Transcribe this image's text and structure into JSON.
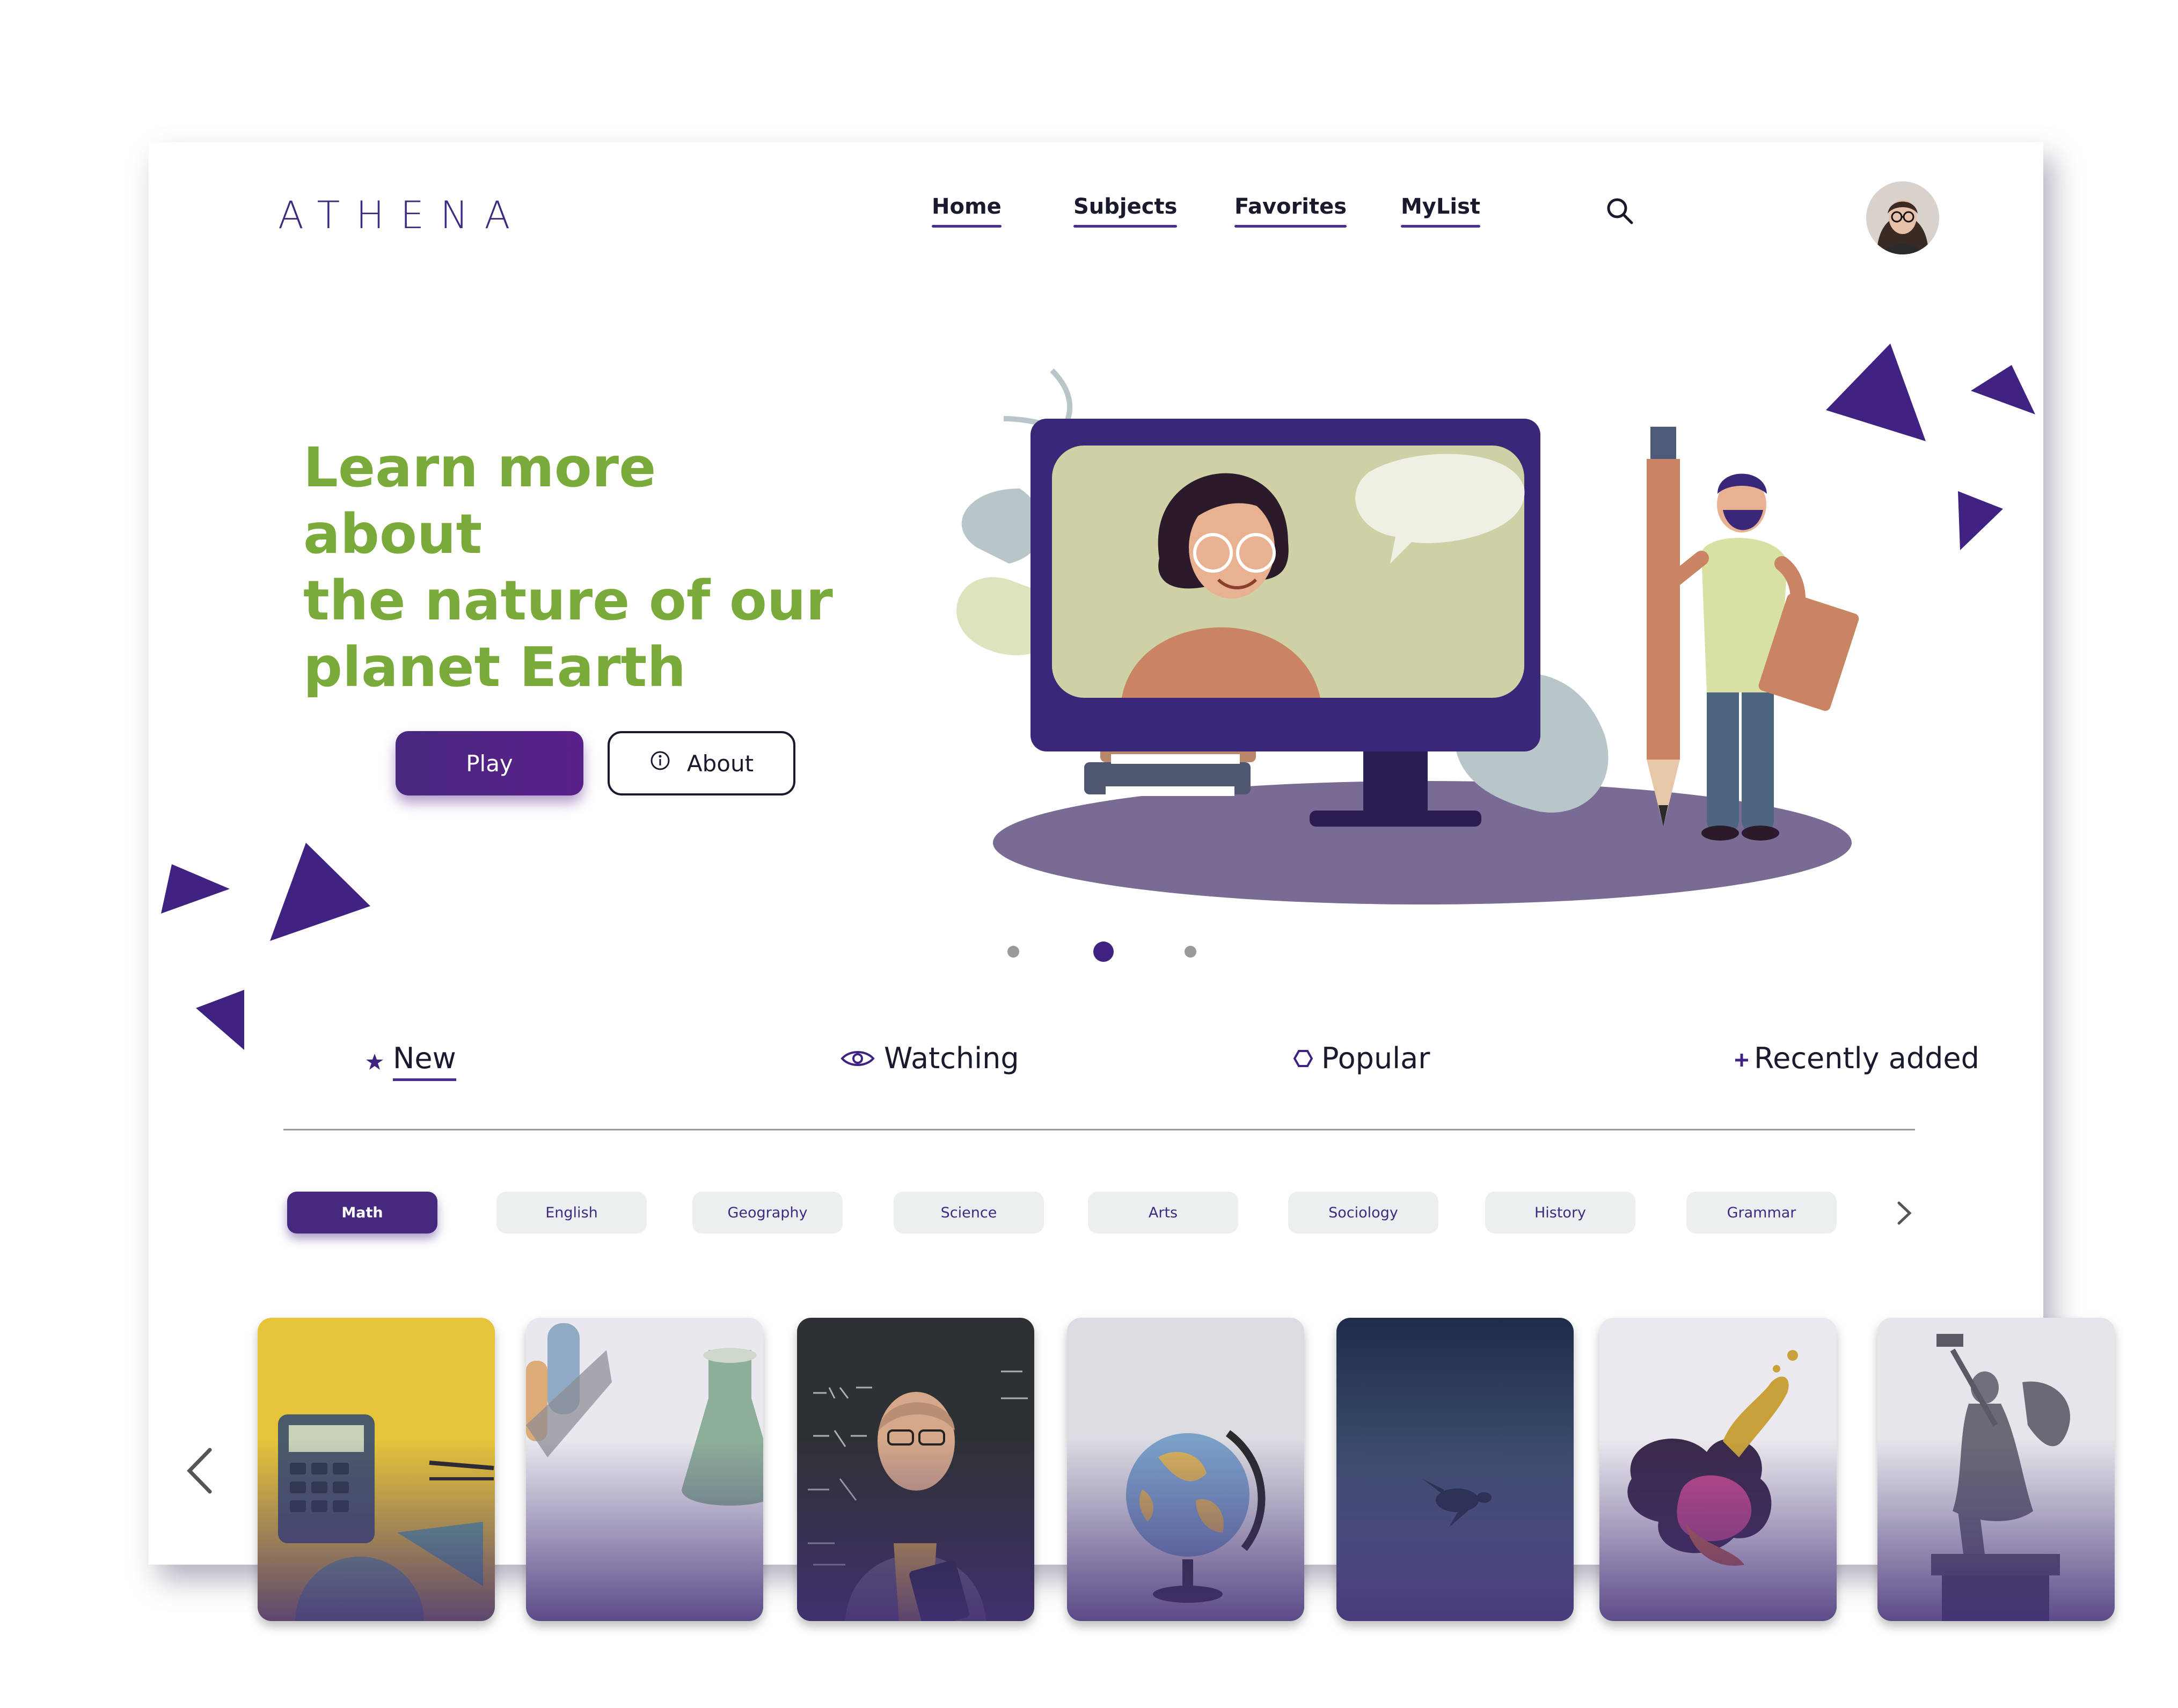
{
  "brand": {
    "logo_text": "ATHENA"
  },
  "nav": {
    "items": [
      {
        "label": "Home"
      },
      {
        "label": "Subjects"
      },
      {
        "label": "Favorites"
      },
      {
        "label": "MyList"
      }
    ],
    "search_icon": "search-icon"
  },
  "hero": {
    "title_lines": [
      "Learn more about",
      "the nature of our",
      "planet Earth"
    ],
    "play_label": "Play",
    "about_label": "About",
    "carousel_index": 2,
    "carousel_count": 3
  },
  "tabs": [
    {
      "label": "New",
      "icon": "star-icon"
    },
    {
      "label": "Watching",
      "icon": "eye-icon"
    },
    {
      "label": "Popular",
      "icon": "hexagon-icon"
    },
    {
      "label": "Recently added",
      "icon": "plus-icon"
    }
  ],
  "subjects": [
    "Math",
    "English",
    "Geography",
    "Science",
    "Arts",
    "Sociology",
    "History",
    "Grammar"
  ],
  "colors": {
    "brand": "#3f2a80",
    "accent": "#47287f",
    "hero_text": "#7aaa3a",
    "chip_bg": "#ebeff0"
  }
}
